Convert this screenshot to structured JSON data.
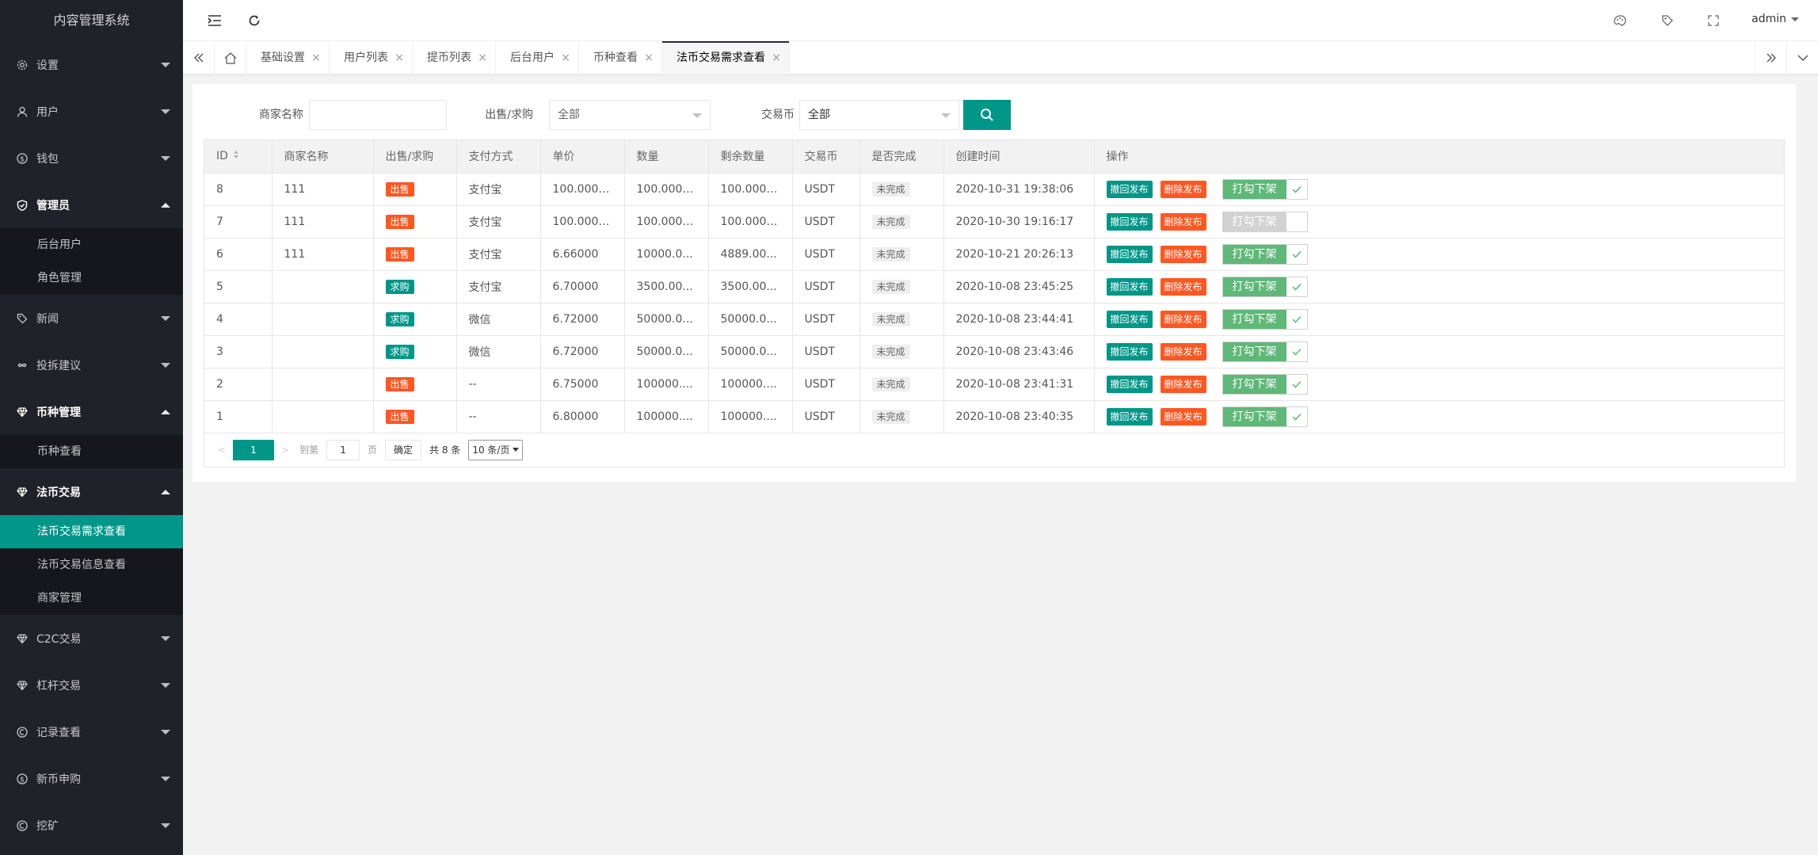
{
  "app": {
    "title": "内容管理系统"
  },
  "colors": {
    "accent": "#009688",
    "sidebar_bg": "#20222a",
    "sell": "#ff5722",
    "switch_on": "#5fb878",
    "switch_off": "#d2d2d2"
  },
  "sidebar": {
    "items": [
      {
        "label": "设置",
        "icon": "gear-icon",
        "open": false
      },
      {
        "label": "用户",
        "icon": "user-icon",
        "open": false
      },
      {
        "label": "钱包",
        "icon": "dollar-icon",
        "open": false
      },
      {
        "label": "管理员",
        "icon": "shield-icon",
        "open": true,
        "children": [
          "后台用户",
          "角色管理"
        ]
      },
      {
        "label": "新闻",
        "icon": "tag-icon",
        "open": false
      },
      {
        "label": "投拆建议",
        "icon": "infinity-icon",
        "open": false
      },
      {
        "label": "币种管理",
        "icon": "diamond-icon",
        "open": true,
        "children": [
          "币种查看"
        ]
      },
      {
        "label": "法币交易",
        "icon": "diamond-icon",
        "open": true,
        "children": [
          "法币交易需求查看",
          "法币交易信息查看",
          "商家管理"
        ],
        "active_child": 0
      },
      {
        "label": "C2C交易",
        "icon": "diamond-icon",
        "open": false
      },
      {
        "label": "杠杆交易",
        "icon": "diamond-icon",
        "open": false
      },
      {
        "label": "记录查看",
        "icon": "record-icon",
        "open": false
      },
      {
        "label": "新币申购",
        "icon": "dollar-icon",
        "open": false
      },
      {
        "label": "挖矿",
        "icon": "record-icon",
        "open": false
      }
    ]
  },
  "header": {
    "user": "admin",
    "icons": [
      "flex-icon",
      "refresh-icon",
      "theme-icon",
      "note-icon",
      "fullscreen-icon"
    ]
  },
  "tabs": {
    "items": [
      "基础设置",
      "用户列表",
      "提币列表",
      "后台用户",
      "币种查看",
      "法币交易需求查看"
    ],
    "active": 5
  },
  "search": {
    "merchant_label": "商家名称",
    "merchant_value": "",
    "type_label": "出售/求购",
    "type_value": "全部",
    "coin_label": "交易币",
    "coin_value": "全部"
  },
  "table": {
    "headers": [
      "ID",
      "商家名称",
      "出售/求购",
      "支付方式",
      "单价",
      "数量",
      "剩余数量",
      "交易币",
      "是否完成",
      "创建时间",
      "操作"
    ],
    "rows": [
      {
        "id": "8",
        "merchant": "111",
        "type": "出售",
        "type_kind": "sell",
        "pay": "支付宝",
        "price": "100.00000",
        "qty": "100.00000",
        "remain": "100.00000",
        "coin": "USDT",
        "done": "未完成",
        "time": "2020-10-31 19:38:06",
        "switch_on": true
      },
      {
        "id": "7",
        "merchant": "111",
        "type": "出售",
        "type_kind": "sell",
        "pay": "支付宝",
        "price": "100.00000",
        "qty": "100.00000",
        "remain": "100.00000",
        "coin": "USDT",
        "done": "未完成",
        "time": "2020-10-30 19:16:17",
        "switch_on": false
      },
      {
        "id": "6",
        "merchant": "111",
        "type": "出售",
        "type_kind": "sell",
        "pay": "支付宝",
        "price": "6.66000",
        "qty": "10000.0...",
        "remain": "4889.00...",
        "coin": "USDT",
        "done": "未完成",
        "time": "2020-10-21 20:26:13",
        "switch_on": true
      },
      {
        "id": "5",
        "merchant": "",
        "type": "求购",
        "type_kind": "buy",
        "pay": "支付宝",
        "price": "6.70000",
        "qty": "3500.00...",
        "remain": "3500.00...",
        "coin": "USDT",
        "done": "未完成",
        "time": "2020-10-08 23:45:25",
        "switch_on": true
      },
      {
        "id": "4",
        "merchant": "",
        "type": "求购",
        "type_kind": "buy",
        "pay": "微信",
        "price": "6.72000",
        "qty": "50000.0...",
        "remain": "50000.0...",
        "coin": "USDT",
        "done": "未完成",
        "time": "2020-10-08 23:44:41",
        "switch_on": true
      },
      {
        "id": "3",
        "merchant": "",
        "type": "求购",
        "type_kind": "buy",
        "pay": "微信",
        "price": "6.72000",
        "qty": "50000.0...",
        "remain": "50000.0...",
        "coin": "USDT",
        "done": "未完成",
        "time": "2020-10-08 23:43:46",
        "switch_on": true
      },
      {
        "id": "2",
        "merchant": "",
        "type": "出售",
        "type_kind": "sell",
        "pay": "--",
        "price": "6.75000",
        "qty": "100000....",
        "remain": "100000....",
        "coin": "USDT",
        "done": "未完成",
        "time": "2020-10-08 23:41:31",
        "switch_on": true
      },
      {
        "id": "1",
        "merchant": "",
        "type": "出售",
        "type_kind": "sell",
        "pay": "--",
        "price": "6.80000",
        "qty": "100000....",
        "remain": "100000....",
        "coin": "USDT",
        "done": "未完成",
        "time": "2020-10-08 23:40:35",
        "switch_on": true
      }
    ],
    "actions": {
      "revoke": "撤回发布",
      "delete": "删除发布",
      "toggle": "打勾下架"
    }
  },
  "pager": {
    "current": "1",
    "goto_label": "到第",
    "goto_value": "1",
    "page_label": "页",
    "confirm": "确定",
    "total": "共 8 条",
    "page_size": "10 条/页"
  }
}
